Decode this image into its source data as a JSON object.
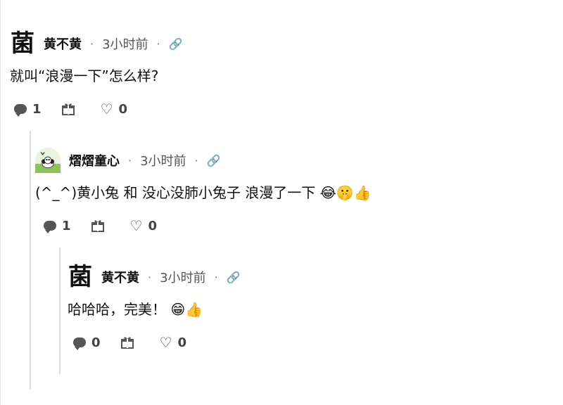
{
  "comments": [
    {
      "author": "黄不黄",
      "avatar_glyph": "菌",
      "separator": "·",
      "time": "3小时前",
      "link_icon": "link-icon",
      "body": "就叫“浪漫一下”怎么样?",
      "replies": "1",
      "likes": "0"
    },
    {
      "author": "熠熠童心",
      "separator": "·",
      "time": "3小时前",
      "link_icon": "link-icon",
      "body": "(^_^)黄小兔 和 没心没肺小兔子 浪漫了一下 😂🤫👍",
      "replies": "1",
      "likes": "0"
    },
    {
      "author": "黄不黄",
      "avatar_glyph": "菌",
      "separator": "·",
      "time": "3小时前",
      "link_icon": "link-icon",
      "body": "哈哈哈，完美！ 😁👍",
      "replies": "0",
      "likes": "0"
    }
  ],
  "colors": {
    "thread_line": "#dcdcdc",
    "meta_text": "#555555",
    "accent_green": "#7cbf4a"
  }
}
